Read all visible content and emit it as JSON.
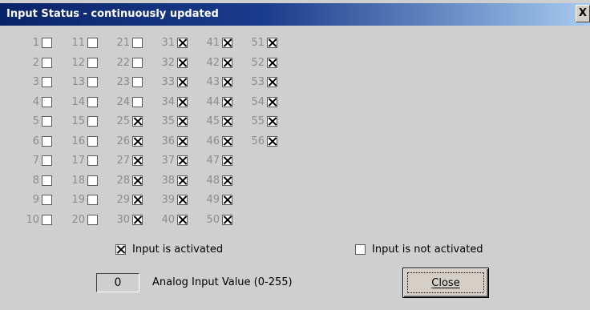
{
  "window": {
    "title": "Input Status - continuously updated",
    "close_glyph": "X"
  },
  "inputs": {
    "columns": [
      {
        "items": [
          {
            "label": "1",
            "checked": false
          },
          {
            "label": "2",
            "checked": false
          },
          {
            "label": "3",
            "checked": false
          },
          {
            "label": "4",
            "checked": false
          },
          {
            "label": "5",
            "checked": false
          },
          {
            "label": "6",
            "checked": false
          },
          {
            "label": "7",
            "checked": false
          },
          {
            "label": "8",
            "checked": false
          },
          {
            "label": "9",
            "checked": false
          },
          {
            "label": "10",
            "checked": false
          }
        ]
      },
      {
        "items": [
          {
            "label": "11",
            "checked": false
          },
          {
            "label": "12",
            "checked": false
          },
          {
            "label": "13",
            "checked": false
          },
          {
            "label": "14",
            "checked": false
          },
          {
            "label": "15",
            "checked": false
          },
          {
            "label": "16",
            "checked": false
          },
          {
            "label": "17",
            "checked": false
          },
          {
            "label": "18",
            "checked": false
          },
          {
            "label": "19",
            "checked": false
          },
          {
            "label": "20",
            "checked": false
          }
        ]
      },
      {
        "items": [
          {
            "label": "21",
            "checked": false
          },
          {
            "label": "22",
            "checked": false
          },
          {
            "label": "23",
            "checked": false
          },
          {
            "label": "24",
            "checked": false
          },
          {
            "label": "25",
            "checked": true
          },
          {
            "label": "26",
            "checked": true
          },
          {
            "label": "27",
            "checked": true
          },
          {
            "label": "28",
            "checked": true
          },
          {
            "label": "29",
            "checked": true
          },
          {
            "label": "30",
            "checked": true
          }
        ]
      },
      {
        "items": [
          {
            "label": "31",
            "checked": true
          },
          {
            "label": "32",
            "checked": true
          },
          {
            "label": "33",
            "checked": true
          },
          {
            "label": "34",
            "checked": true
          },
          {
            "label": "35",
            "checked": true
          },
          {
            "label": "36",
            "checked": true
          },
          {
            "label": "37",
            "checked": true
          },
          {
            "label": "38",
            "checked": true
          },
          {
            "label": "39",
            "checked": true
          },
          {
            "label": "40",
            "checked": true
          }
        ]
      },
      {
        "items": [
          {
            "label": "41",
            "checked": true
          },
          {
            "label": "42",
            "checked": true
          },
          {
            "label": "43",
            "checked": true
          },
          {
            "label": "44",
            "checked": true
          },
          {
            "label": "45",
            "checked": true
          },
          {
            "label": "46",
            "checked": true
          },
          {
            "label": "47",
            "checked": true
          },
          {
            "label": "48",
            "checked": true
          },
          {
            "label": "49",
            "checked": true
          },
          {
            "label": "50",
            "checked": true
          }
        ]
      },
      {
        "items": [
          {
            "label": "51",
            "checked": true
          },
          {
            "label": "52",
            "checked": true
          },
          {
            "label": "53",
            "checked": true
          },
          {
            "label": "54",
            "checked": true
          },
          {
            "label": "55",
            "checked": true
          },
          {
            "label": "56",
            "checked": true
          }
        ]
      }
    ]
  },
  "legend": {
    "activated_label": "Input is activated",
    "not_activated_label": "Input is not activated"
  },
  "analog": {
    "value": "0",
    "label": "Analog Input Value (0-255)"
  },
  "actions": {
    "close_label": "Close"
  },
  "colors": {
    "titlebar_start": "#0a246a",
    "titlebar_end": "#a6caf0",
    "dialog_bg": "#cfcfcf",
    "input_number": "#8c8c8c"
  }
}
